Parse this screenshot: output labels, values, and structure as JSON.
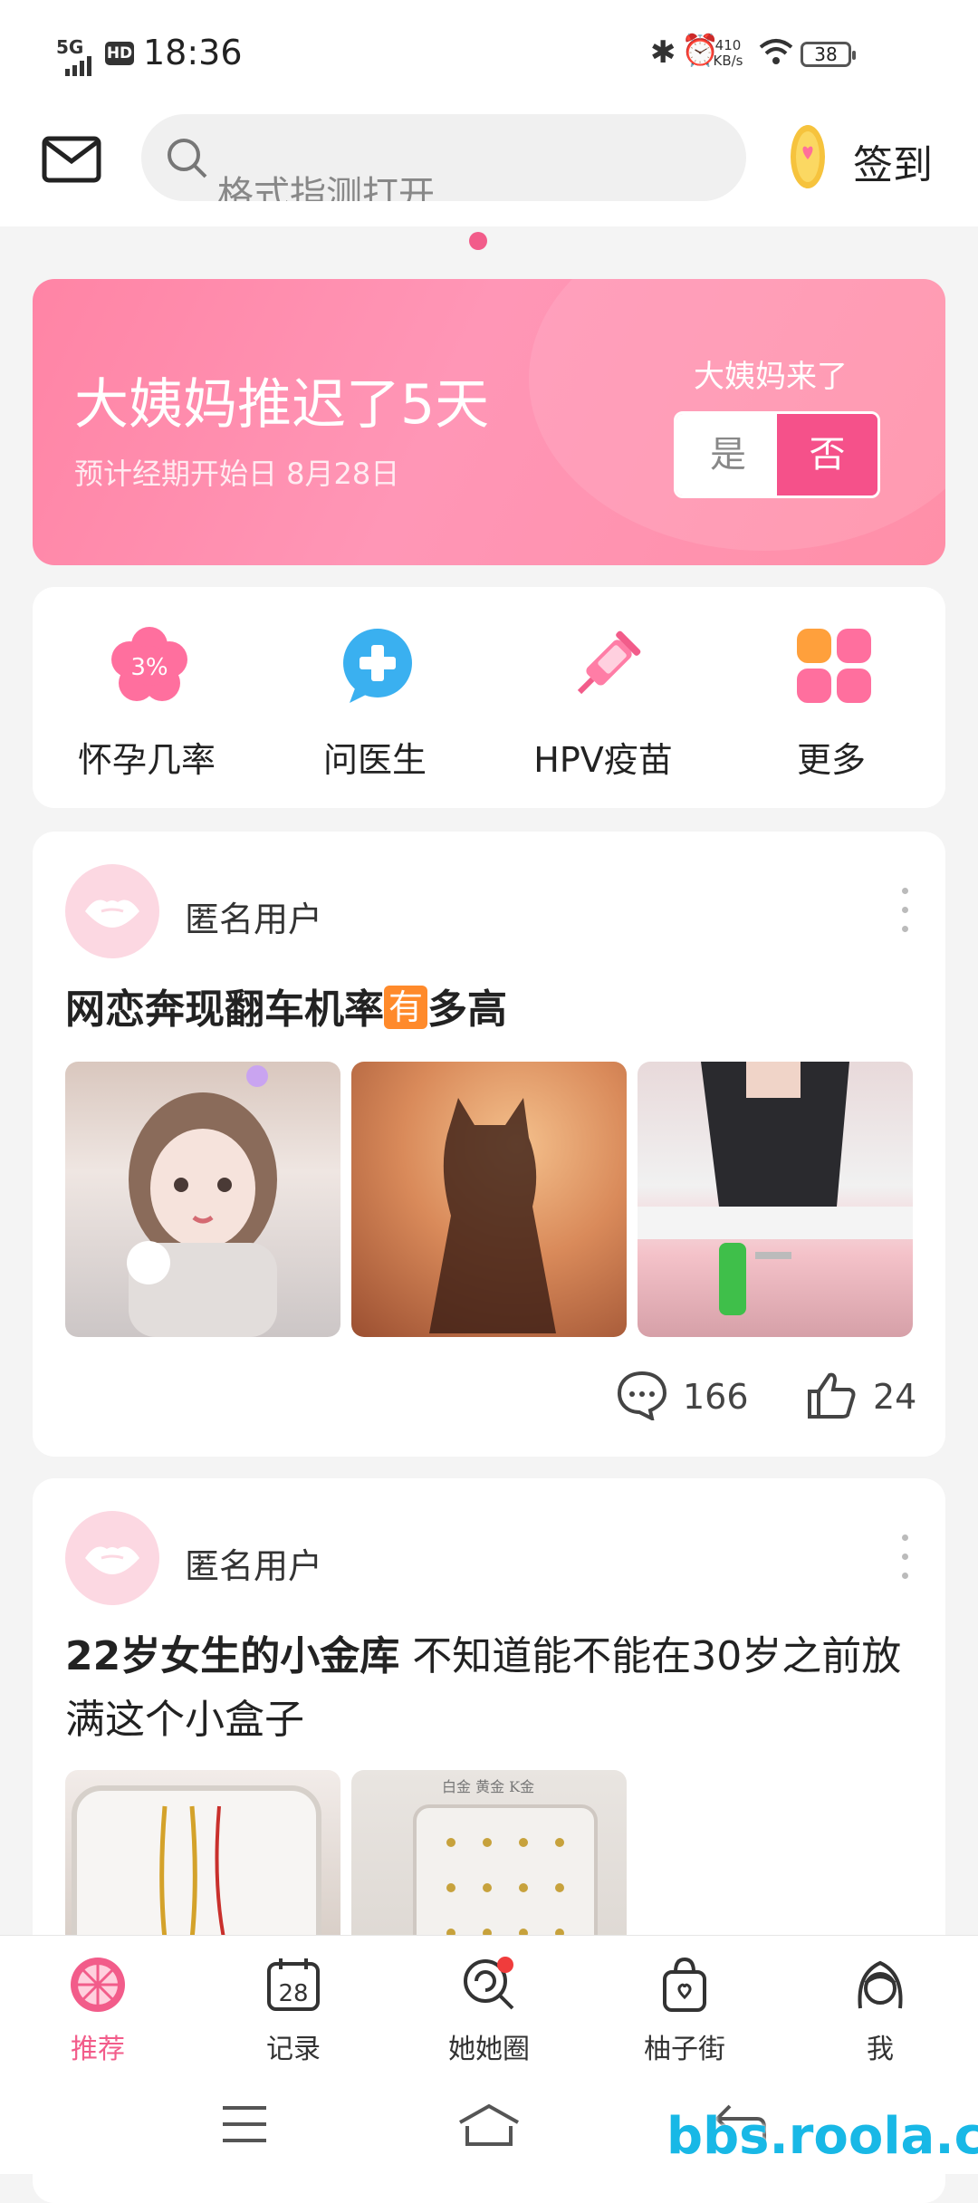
{
  "status_bar": {
    "network": "5G",
    "hd": "HD",
    "time": "18:36",
    "speed_value": "410",
    "speed_unit": "KB/s",
    "battery": "38"
  },
  "header": {
    "search_placeholder": "格式指测打开",
    "checkin_label": "签到"
  },
  "period_card": {
    "title": "大姨妈推迟了5天",
    "subtitle": "预计经期开始日 8月28日",
    "question": "大姨妈来了",
    "yes_label": "是",
    "no_label": "否"
  },
  "quick_actions": [
    {
      "label": "怀孕几率",
      "icon": "flower-percent-icon",
      "icon_text": "3%"
    },
    {
      "label": "问医生",
      "icon": "doctor-chat-icon"
    },
    {
      "label": "HPV疫苗",
      "icon": "syringe-icon"
    },
    {
      "label": "更多",
      "icon": "grid-more-icon"
    }
  ],
  "posts": [
    {
      "author": "匿名用户",
      "title_pre": "网恋奔现翻车机率",
      "badge": "有",
      "title_post": "多高",
      "comments": "166",
      "likes": "24"
    },
    {
      "author": "匿名用户",
      "title_bold": "22岁女生的小金库",
      "title_rest": " 不知道能不能在30岁之前放满这个小盒子",
      "image_caption": "白金 黄金 K金"
    }
  ],
  "bottom_nav": [
    {
      "label": "推荐",
      "icon": "grapefruit-icon",
      "active": true
    },
    {
      "label": "记录",
      "icon": "calendar-icon",
      "icon_text": "28"
    },
    {
      "label": "她她圈",
      "icon": "lollipop-icon"
    },
    {
      "label": "柚子街",
      "icon": "shopping-bag-icon"
    },
    {
      "label": "我",
      "icon": "profile-icon"
    }
  ],
  "colors": {
    "accent": "#f25c8a",
    "card_gradient_start": "#ff84a5",
    "toggle_active": "#f5518a",
    "watermark": "#18b8e6"
  },
  "watermark": "bbs.roola.cn"
}
